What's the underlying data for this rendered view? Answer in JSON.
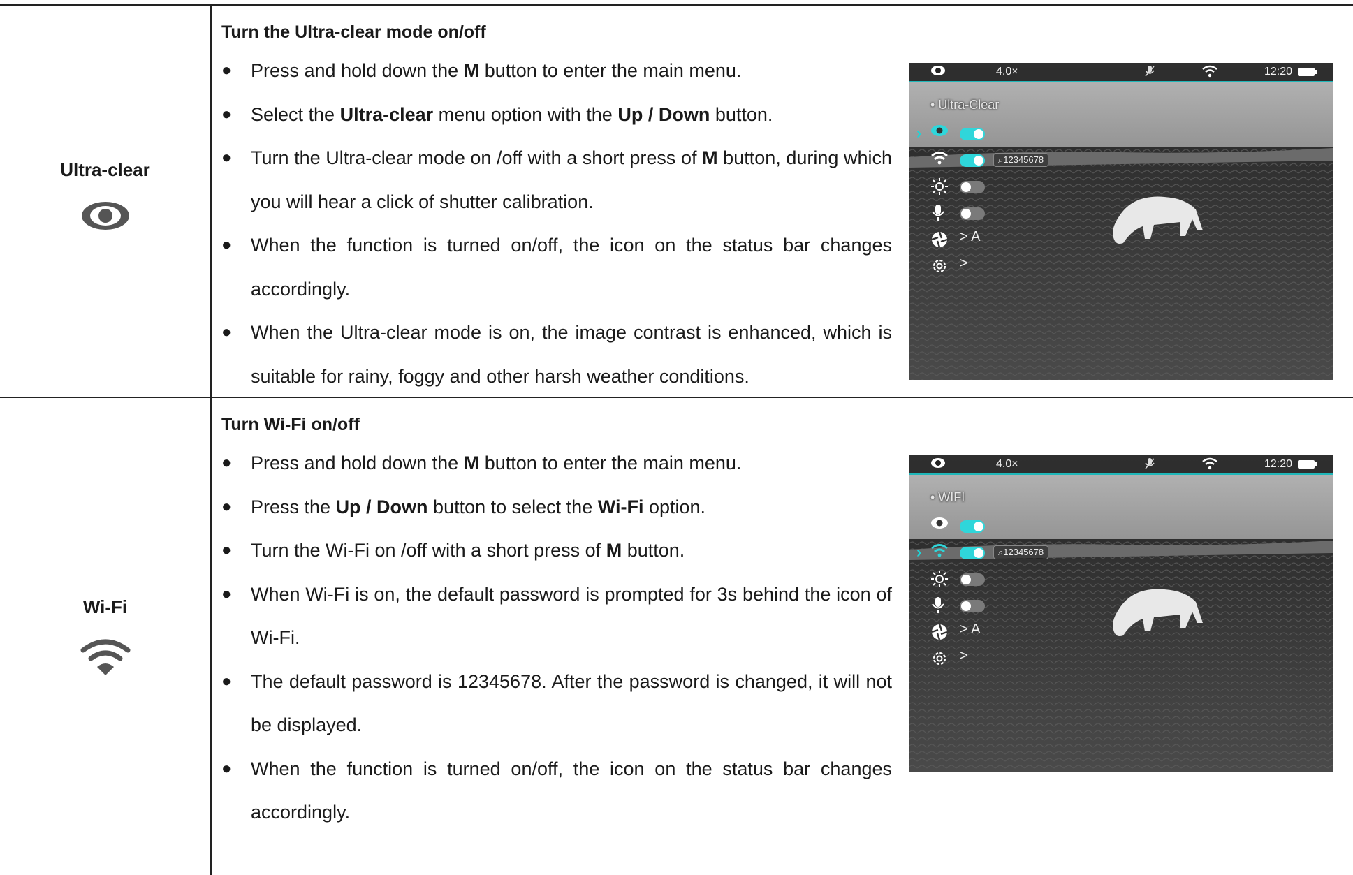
{
  "sections": [
    {
      "label": "Ultra-clear",
      "icon": "eye-icon",
      "heading": "Turn the Ultra-clear mode on/off",
      "bullets": [
        {
          "parts": [
            [
              "Press and hold down the ",
              false
            ],
            [
              "M",
              true
            ],
            [
              " button to enter the main menu.",
              false
            ]
          ]
        },
        {
          "parts": [
            [
              "Select the ",
              false
            ],
            [
              "Ultra-clear",
              true
            ],
            [
              " menu option with the ",
              false
            ],
            [
              "Up / Down",
              true
            ],
            [
              " button.",
              false
            ]
          ]
        },
        {
          "parts": [
            [
              "Turn the Ultra-clear mode on /off with a short press of ",
              false
            ],
            [
              "M",
              true
            ],
            [
              " button, during which you will hear a click of shutter calibration.",
              false
            ]
          ]
        },
        {
          "parts": [
            [
              "When the function is turned on/off, the icon on the status bar changes accordingly.",
              false
            ]
          ]
        },
        {
          "parts": [
            [
              "When the Ultra-clear mode is on, the image contrast is enhanced, which is suitable for rainy, foggy and other harsh weather conditions.",
              false
            ]
          ]
        }
      ],
      "screen": {
        "zoom": "4.0×",
        "time": "12:20",
        "menu_title": "• Ultra-Clear",
        "selected_row": 0,
        "password_tag": "12345678",
        "sub_a": "> A",
        "sub_settings": ">"
      }
    },
    {
      "label": "Wi-Fi",
      "icon": "wifi-icon",
      "heading": "Turn Wi-Fi on/off",
      "bullets": [
        {
          "parts": [
            [
              "Press and hold down the ",
              false
            ],
            [
              "M",
              true
            ],
            [
              " button to enter the main menu.",
              false
            ]
          ]
        },
        {
          "parts": [
            [
              "Press the ",
              false
            ],
            [
              "Up / Down",
              true
            ],
            [
              " button to select the ",
              false
            ],
            [
              "Wi-Fi",
              true
            ],
            [
              " option.",
              false
            ]
          ]
        },
        {
          "parts": [
            [
              "Turn the Wi-Fi on /off with a short press of ",
              false
            ],
            [
              "M",
              true
            ],
            [
              " button.",
              false
            ]
          ]
        },
        {
          "parts": [
            [
              "When Wi-Fi is on, the default password is prompted for 3s behind the icon of Wi-Fi.",
              false
            ]
          ]
        },
        {
          "parts": [
            [
              "The default password is 12345678. After the password is changed, it will not be displayed.",
              false
            ]
          ]
        },
        {
          "parts": [
            [
              "When the function is turned on/off, the icon on the status bar changes accordingly.",
              false
            ]
          ]
        }
      ],
      "screen": {
        "zoom": "4.0×",
        "time": "12:20",
        "menu_title": "• WIFI",
        "selected_row": 1,
        "password_tag": "12345678",
        "sub_a": "> A",
        "sub_settings": ">"
      }
    }
  ],
  "colors": {
    "accent": "#2fd6da",
    "text": "#1a1a1a",
    "rule": "#222222"
  }
}
